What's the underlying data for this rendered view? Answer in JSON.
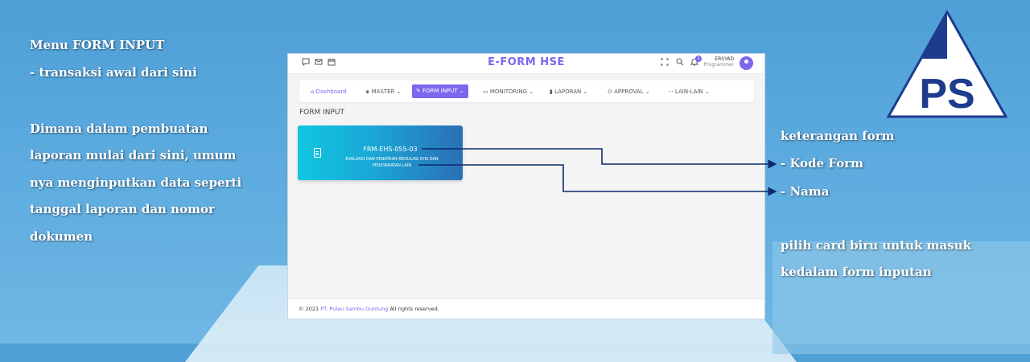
{
  "annotations": {
    "left_heading": "Menu FORM INPUT",
    "left_sub": "- transaksi awal dari sini",
    "left_para": [
      "Dimana dalam pembuatan",
      "laporan mulai dari sini, umum",
      "nya menginputkan data seperti",
      "tanggal laporan dan nomor",
      "dokumen"
    ],
    "right_title": "keterangan form",
    "right_code": "- Kode Form",
    "right_name": "- Nama",
    "right_hint": [
      "pilih card biru untuk masuk",
      "kedalam form inputan"
    ]
  },
  "logo": {
    "text": "PS",
    "color": "#1d3c8e"
  },
  "app": {
    "title": "E-FORM HSE",
    "user_name": "ERSYAD",
    "user_role": "Programmer",
    "notification_count": "1",
    "accent": "#7b68ee"
  },
  "menu": [
    {
      "label": "Dashboard",
      "icon": "home-icon"
    },
    {
      "label": "MASTER",
      "icon": "layers-icon"
    },
    {
      "label": "FORM INPUT",
      "icon": "edit-icon"
    },
    {
      "label": "MONITORING",
      "icon": "monitor-icon"
    },
    {
      "label": "LAPORAN",
      "icon": "bar-chart-icon"
    },
    {
      "label": "APPROVAL",
      "icon": "check-circle-icon"
    },
    {
      "label": "LAIN-LAIN",
      "icon": "more-icon"
    }
  ],
  "section_title": "FORM INPUT",
  "card": {
    "code": "FRM-EHS-055-03",
    "name": "EVALUASI DAN PENATAAN REGULASI EHS DAN PERSYARATAN LAIN"
  },
  "footer": {
    "year": "© 2021",
    "company": "PT. Pulau Sambu Guntung",
    "rights": "All rights reserved."
  }
}
